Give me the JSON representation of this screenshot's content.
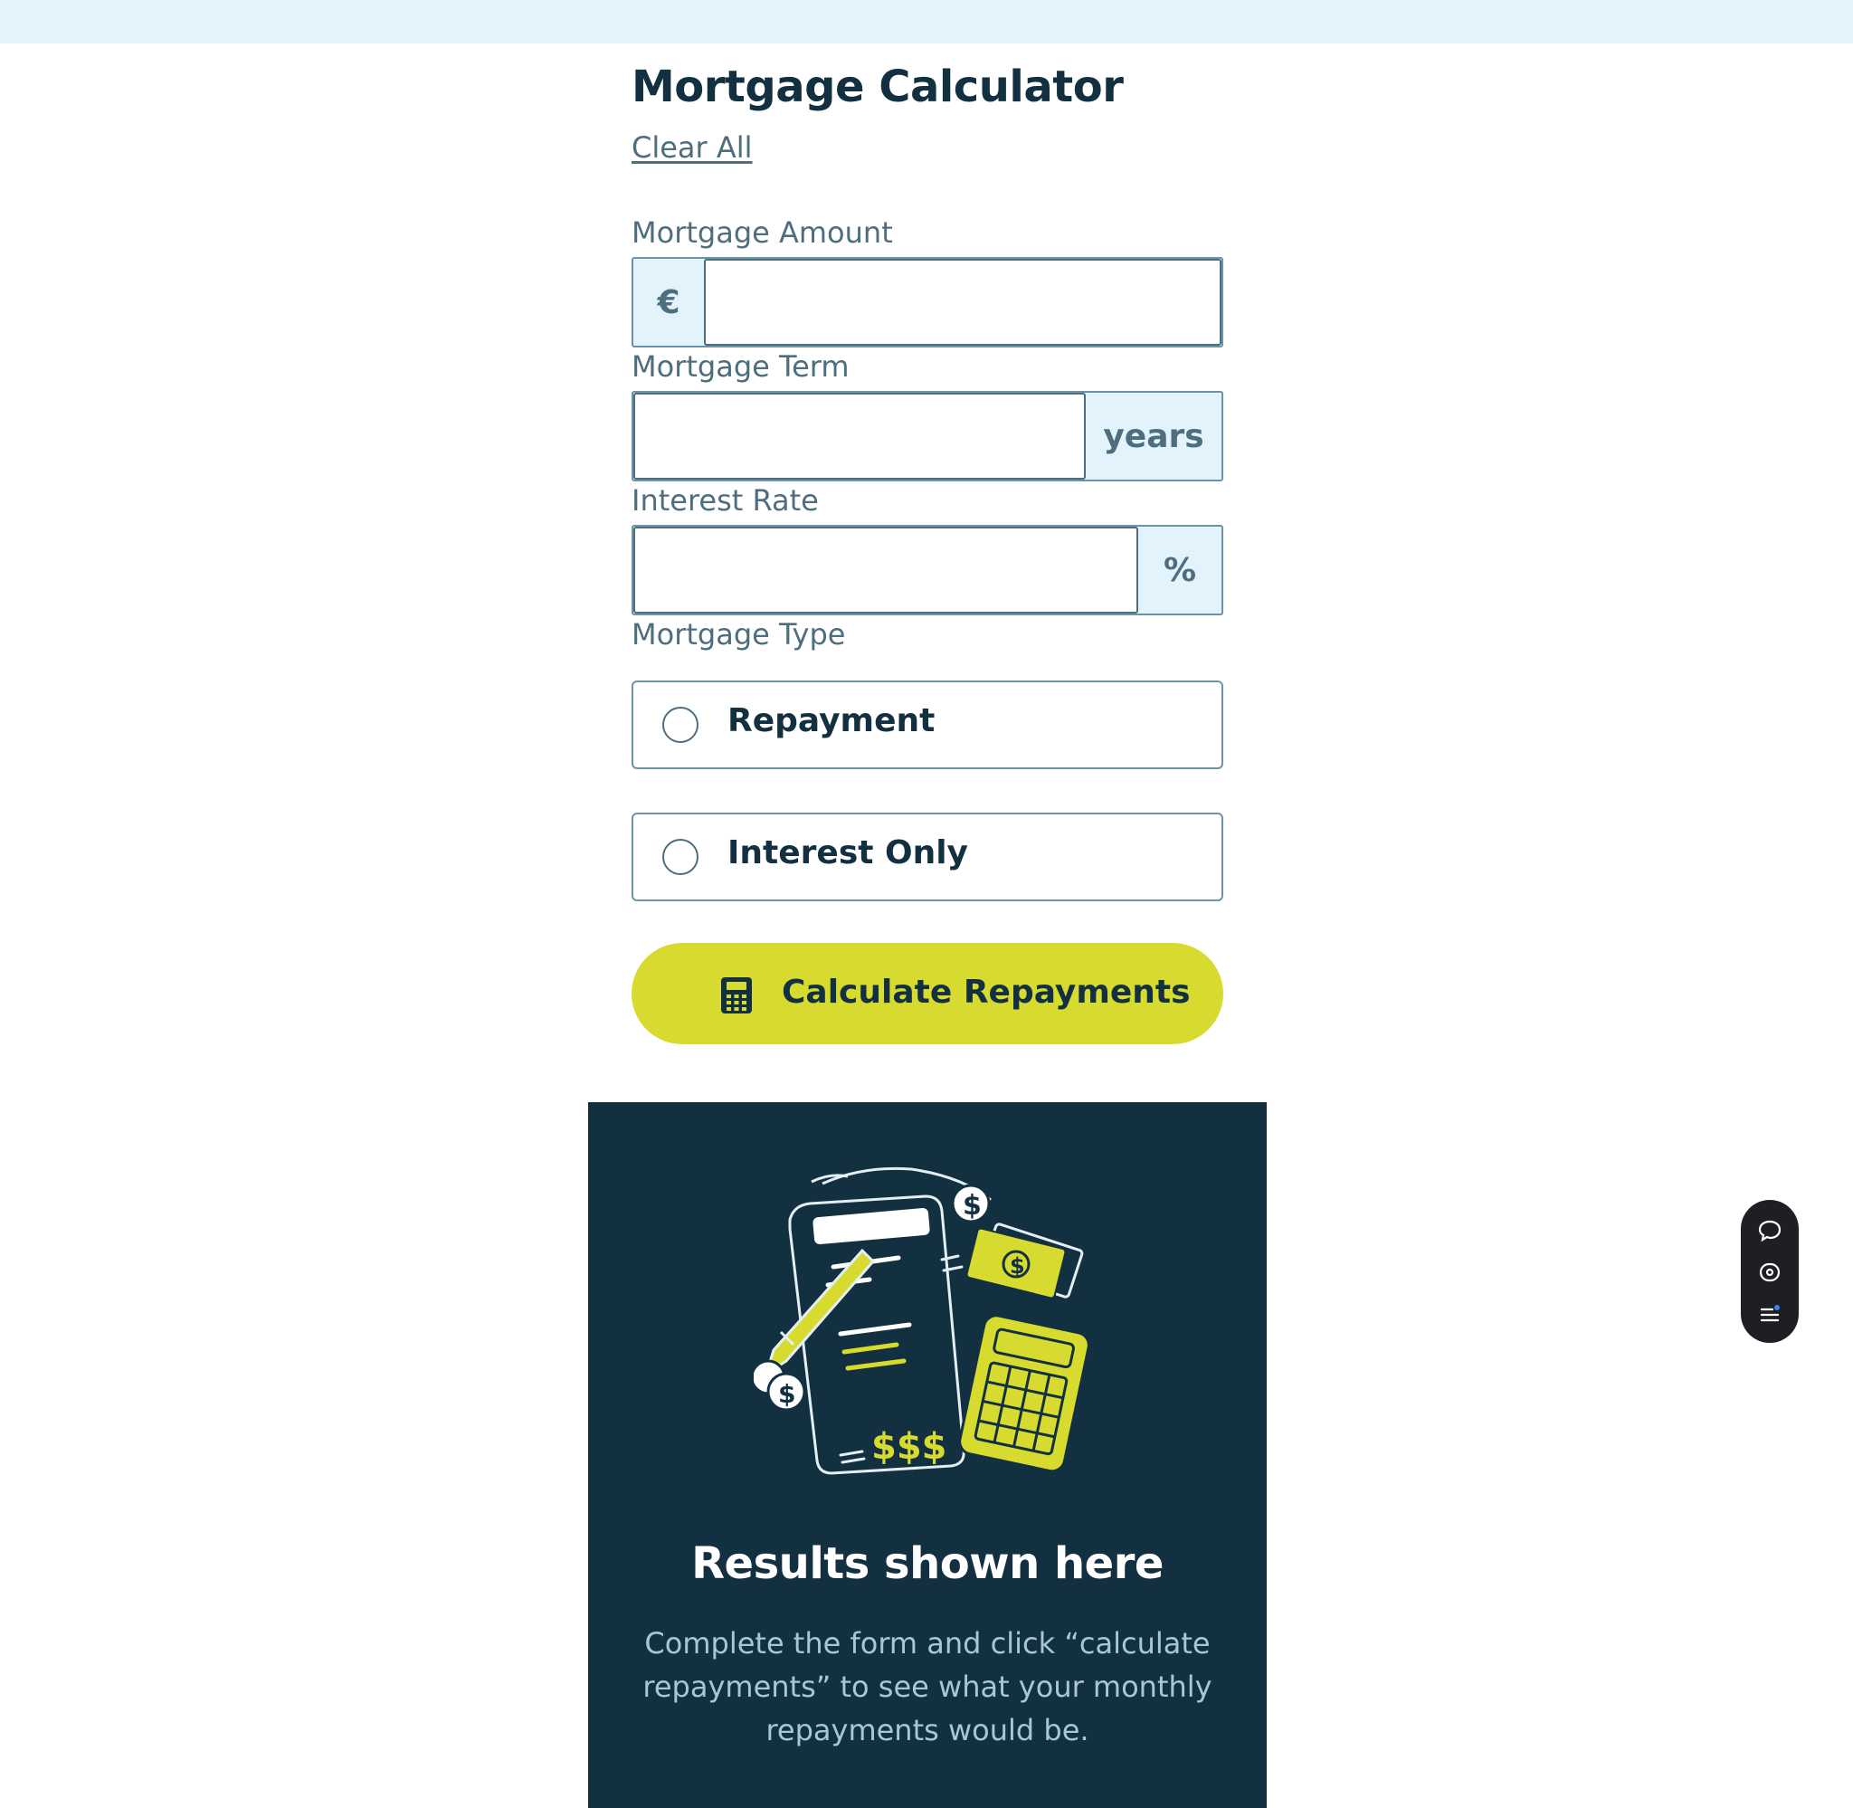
{
  "app": {
    "title": "Mortgage Calculator",
    "clear_all_label": "Clear All"
  },
  "fields": {
    "amount": {
      "label": "Mortgage Amount",
      "prefix": "€",
      "value": ""
    },
    "term": {
      "label": "Mortgage Term",
      "suffix": "years",
      "value": ""
    },
    "rate": {
      "label": "Interest Rate",
      "suffix": "%",
      "value": ""
    }
  },
  "mortgage_type": {
    "label": "Mortgage Type",
    "options": [
      {
        "label": "Repayment",
        "selected": false
      },
      {
        "label": "Interest Only",
        "selected": false
      }
    ]
  },
  "calculate_button": {
    "label": "Calculate Repayments",
    "icon": "calculator-icon"
  },
  "results": {
    "title": "Results shown here",
    "description": "Complete the form and click “calculate repayments” to see what your monthly repayments would be.",
    "illustration": "empty-results-illustration"
  },
  "side_tools": [
    "comment-icon",
    "eye-icon",
    "menu-list-icon"
  ],
  "colors": {
    "topbar": "#e3f3fb",
    "navy": "#133041",
    "slate": "#4e6e7e",
    "adornment_bg": "#e3f3fb",
    "lime": "#d8db2f",
    "results_bg": "#133041",
    "results_text": "#a8c6d6"
  }
}
